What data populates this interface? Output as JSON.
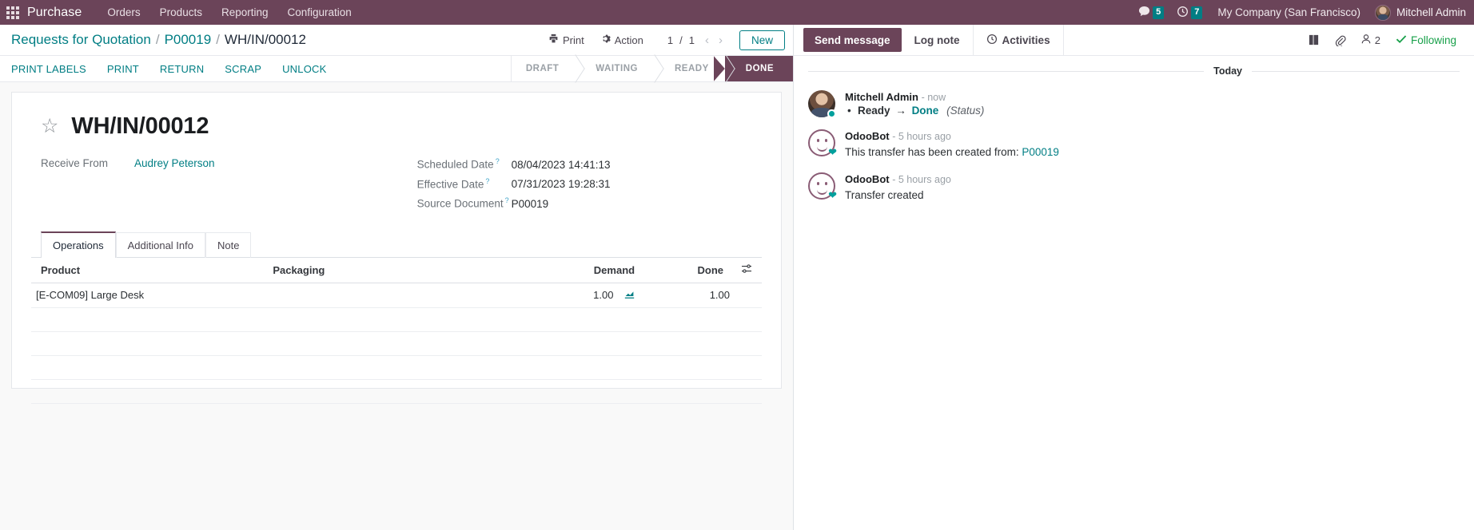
{
  "navbar": {
    "apps_icon": "apps-grid-icon",
    "brand": "Purchase",
    "menu": [
      "Orders",
      "Products",
      "Reporting",
      "Configuration"
    ],
    "messages_icon": "chat-bubble-icon",
    "messages_count": "5",
    "activities_icon": "clock-icon",
    "activities_count": "7",
    "company": "My Company (San Francisco)",
    "user": "Mitchell Admin"
  },
  "control_panel": {
    "breadcrumb": {
      "root": "Requests for Quotation",
      "parent": "P00019",
      "current": "WH/IN/00012",
      "separator": "/"
    },
    "print_label": "Print",
    "print_icon": "printer-icon",
    "action_label": "Action",
    "action_icon": "gear-icon",
    "pager": {
      "value": "1",
      "total": "1",
      "separator": "/",
      "prev_icon": "chevron-left-icon",
      "next_icon": "chevron-right-icon"
    },
    "new_label": "New"
  },
  "statusbar": {
    "buttons": [
      "PRINT LABELS",
      "PRINT",
      "RETURN",
      "SCRAP",
      "UNLOCK"
    ],
    "stages": [
      "DRAFT",
      "WAITING",
      "READY",
      "DONE"
    ],
    "active_stage": "DONE",
    "active_color": "#6b4459"
  },
  "sheet": {
    "star_icon": "star-outline-icon",
    "title": "WH/IN/00012",
    "left_fields": [
      {
        "label": "Receive From",
        "value": "Audrey Peterson",
        "is_link": true,
        "help": false
      }
    ],
    "right_fields": [
      {
        "label": "Scheduled Date",
        "value": "08/04/2023 14:41:13",
        "help": true
      },
      {
        "label": "Effective Date",
        "value": "07/31/2023 19:28:31",
        "help": true
      },
      {
        "label": "Source Document",
        "value": "P00019",
        "help": true
      }
    ],
    "tabs": [
      {
        "label": "Operations",
        "active": true
      },
      {
        "label": "Additional Info",
        "active": false
      },
      {
        "label": "Note",
        "active": false
      }
    ],
    "table": {
      "columns": [
        "Product",
        "Packaging",
        "Demand",
        "Done"
      ],
      "optional_icon": "column-options-icon",
      "rows": [
        {
          "product": "[E-COM09] Large Desk",
          "packaging": "",
          "demand": "1.00",
          "demand_icon": "detailed-operations-icon",
          "done": "1.00"
        }
      ],
      "empty_rows": 4
    }
  },
  "chatter": {
    "send_message": "Send message",
    "log_note": "Log note",
    "activities": "Activities",
    "activities_icon": "clock-outline-icon",
    "attachment_icon": "paperclip-icon",
    "knowledge_icon": "book-icon",
    "followers_icon": "user-icon",
    "followers_count": "2",
    "following_label": "Following",
    "following_icon": "check-icon",
    "following_color": "#18a04a",
    "day_separator": "Today",
    "messages": [
      {
        "author": "Mitchell Admin",
        "time": "- now",
        "avatar": "user-avatar",
        "type": "tracking",
        "tracking": {
          "old_value": "Ready",
          "arrow": "→",
          "new_value": "Done",
          "field": "(Status)"
        }
      },
      {
        "author": "OdooBot",
        "time": "- 5 hours ago",
        "avatar": "odoobot-avatar",
        "type": "text",
        "text": "This transfer has been created from: ",
        "link": "P00019"
      },
      {
        "author": "OdooBot",
        "time": "- 5 hours ago",
        "avatar": "odoobot-avatar",
        "type": "text",
        "text": "Transfer created",
        "link": ""
      }
    ]
  }
}
